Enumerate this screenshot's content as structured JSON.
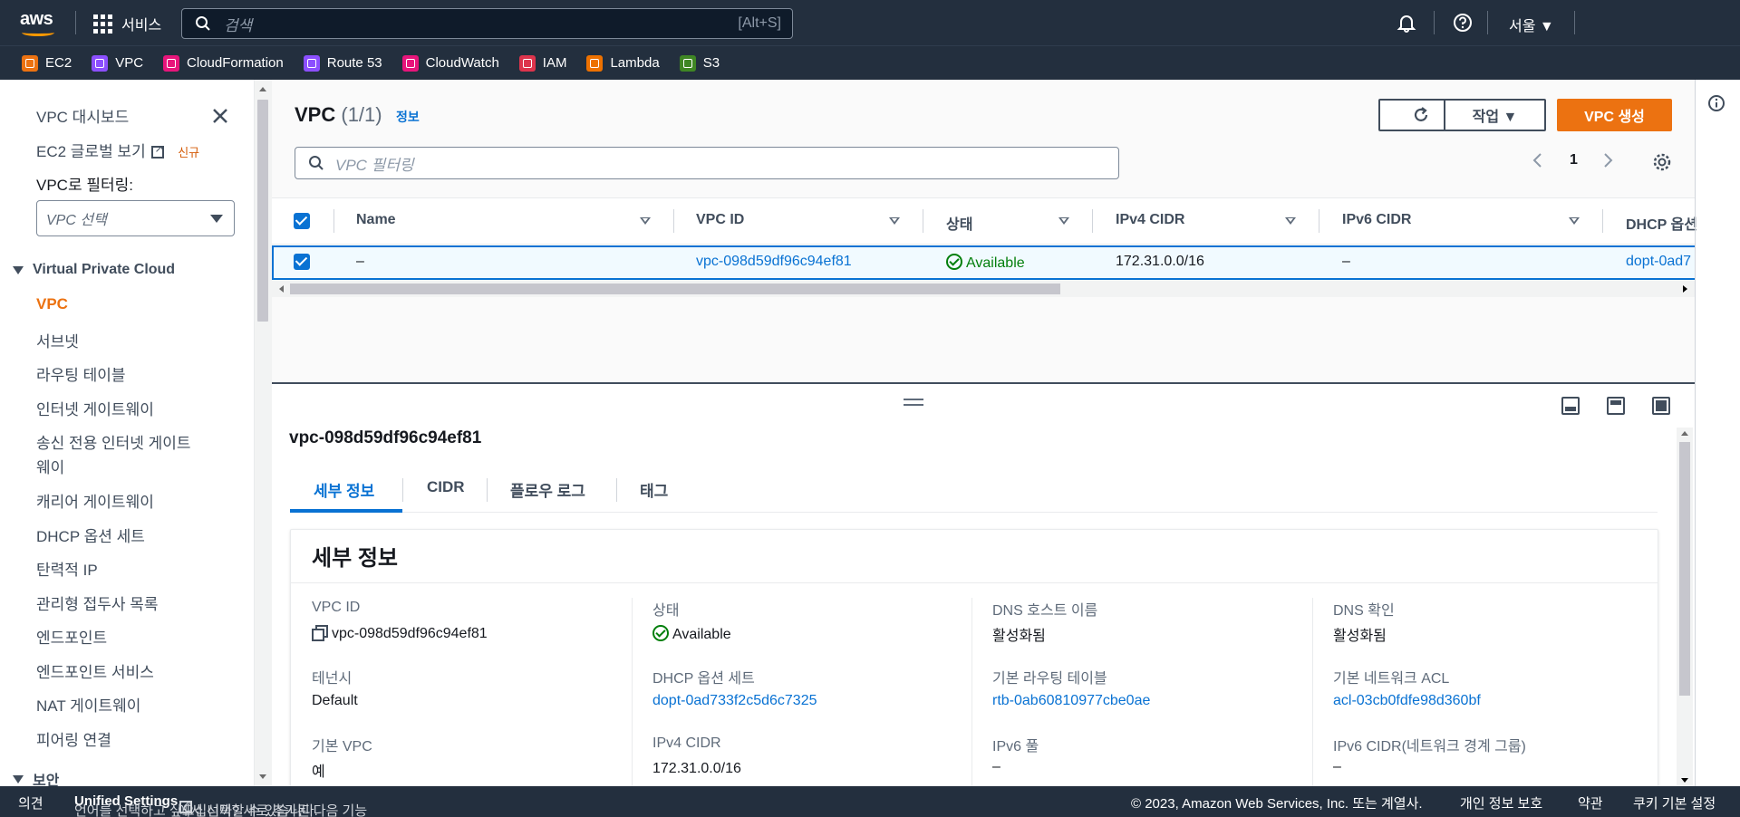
{
  "nav": {
    "logo_text": "aws",
    "services_label": "서비스",
    "search_placeholder": "검색",
    "search_shortcut": "[Alt+S]",
    "region": "서울 ▼",
    "icons": [
      "bell-icon",
      "help-icon"
    ]
  },
  "favorites": [
    {
      "label": "EC2",
      "color": "#ec7211"
    },
    {
      "label": "VPC",
      "color": "#8c4fff"
    },
    {
      "label": "CloudFormation",
      "color": "#e7157b"
    },
    {
      "label": "Route 53",
      "color": "#8c4fff"
    },
    {
      "label": "CloudWatch",
      "color": "#e7157b"
    },
    {
      "label": "IAM",
      "color": "#dd344c"
    },
    {
      "label": "Lambda",
      "color": "#ed7100"
    },
    {
      "label": "S3",
      "color": "#3f8624"
    }
  ],
  "sidebar": {
    "dashboard": "VPC 대시보드",
    "ec2_global": "EC2 글로벌 보기",
    "new_badge": "신규",
    "filter_label": "VPC로 필터링:",
    "filter_placeholder": "VPC 선택",
    "section": "Virtual Private Cloud",
    "items": [
      "VPC",
      "서브넷",
      "라우팅 테이블",
      "인터넷 게이트웨이",
      "송신 전용 인터넷 게이트",
      "웨이",
      "캐리어 게이트웨이",
      "DHCP 옵션 세트",
      "탄력적 IP",
      "관리형 접두사 목록",
      "엔드포인트",
      "엔드포인트 서비스",
      "NAT 게이트웨이",
      "피어링 연결",
      "보안"
    ]
  },
  "header": {
    "title": "VPC",
    "count": "(1/1)",
    "info": "정보",
    "actions": "작업 ▼",
    "create": "VPC 생성",
    "filter_placeholder": "VPC 필터링",
    "page": "1"
  },
  "table": {
    "columns": [
      "Name",
      "VPC ID",
      "상태",
      "IPv4 CIDR",
      "IPv6 CIDR",
      "DHCP 옵션"
    ],
    "row": {
      "name": "–",
      "vpc_id": "vpc-098d59df96c94ef81",
      "state": "Available",
      "ipv4": "172.31.0.0/16",
      "ipv6": "–",
      "dhcp": "dopt-0ad7"
    }
  },
  "detail": {
    "title": "vpc-098d59df96c94ef81",
    "tabs": [
      "세부 정보",
      "CIDR",
      "플로우 로그",
      "태그"
    ],
    "card_title": "세부 정보",
    "fields": [
      {
        "key": "VPC ID",
        "value": "vpc-098d59df96c94ef81"
      },
      {
        "key": "상태",
        "value": "Available"
      },
      {
        "key": "DNS 호스트 이름",
        "value": "활성화됨"
      },
      {
        "key": "DNS 확인",
        "value": "활성화됨"
      },
      {
        "key": "테넌시",
        "value": "Default"
      },
      {
        "key": "DHCP 옵션 세트",
        "value": "dopt-0ad733f2c5d6c7325"
      },
      {
        "key": "기본 라우팅 테이블",
        "value": "rtb-0ab60810977cbe0ae"
      },
      {
        "key": "기본 네트워크 ACL",
        "value": "acl-03cb0fdfe98d360bf"
      },
      {
        "key": "기본 VPC",
        "value": "예"
      },
      {
        "key": "IPv4 CIDR",
        "value": "172.31.0.0/16"
      },
      {
        "key": "IPv6 풀",
        "value": "–"
      },
      {
        "key": "IPv6 CIDR(네트워크 경계 그룹)",
        "value": "–"
      }
    ]
  },
  "footer": {
    "feedback": "의견",
    "lang_msg_1": "언어를 선택하고 싶으십니까? 새로 추가된 다음 기능",
    "unified": "Unified Settings",
    "lang_msg_2": "에서 선택할 수 있습니다.",
    "copyright": "© 2023, Amazon Web Services, Inc. 또는 계열사.",
    "privacy": "개인 정보 보호",
    "terms": "약관",
    "cookies": "쿠키 기본 설정"
  },
  "colors": {
    "nav_bg": "#232f3e",
    "primary": "#ec7211",
    "link": "#0972d3",
    "success": "#037f0c"
  }
}
